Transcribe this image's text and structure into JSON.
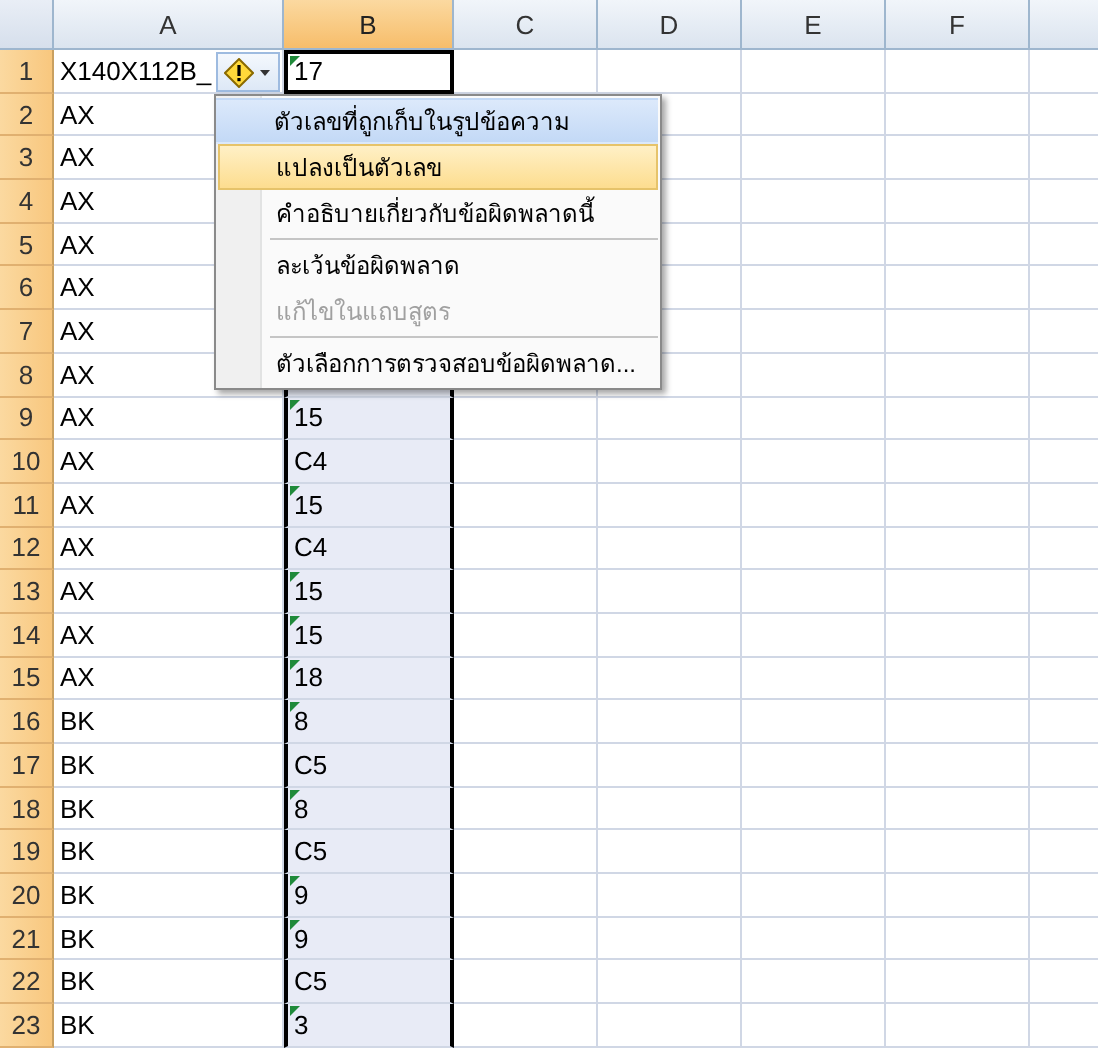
{
  "columns": [
    {
      "label": "A",
      "selected": false
    },
    {
      "label": "B",
      "selected": true
    },
    {
      "label": "C",
      "selected": false
    },
    {
      "label": "D",
      "selected": false
    },
    {
      "label": "E",
      "selected": false
    },
    {
      "label": "F",
      "selected": false
    }
  ],
  "rows": [
    {
      "number": "1",
      "a": "X140X112B_",
      "b": "17",
      "error_flag": true
    },
    {
      "number": "2",
      "a": "AX"
    },
    {
      "number": "3",
      "a": "AX"
    },
    {
      "number": "4",
      "a": "AX"
    },
    {
      "number": "5",
      "a": "AX"
    },
    {
      "number": "6",
      "a": "AX"
    },
    {
      "number": "7",
      "a": "AX"
    },
    {
      "number": "8",
      "a": "AX"
    },
    {
      "number": "9",
      "a": "AX",
      "b": "15",
      "error_flag": true
    },
    {
      "number": "10",
      "a": "AX",
      "b": "C4",
      "error_flag": false
    },
    {
      "number": "11",
      "a": "AX",
      "b": "15",
      "error_flag": true
    },
    {
      "number": "12",
      "a": "AX",
      "b": "C4",
      "error_flag": false
    },
    {
      "number": "13",
      "a": "AX",
      "b": "15",
      "error_flag": true
    },
    {
      "number": "14",
      "a": "AX",
      "b": "15",
      "error_flag": true
    },
    {
      "number": "15",
      "a": "AX",
      "b": "18",
      "error_flag": true
    },
    {
      "number": "16",
      "a": "BK",
      "b": "8",
      "error_flag": true
    },
    {
      "number": "17",
      "a": "BK",
      "b": "C5",
      "error_flag": false
    },
    {
      "number": "18",
      "a": "BK",
      "b": "8",
      "error_flag": true
    },
    {
      "number": "19",
      "a": "BK",
      "b": "C5",
      "error_flag": false
    },
    {
      "number": "20",
      "a": "BK",
      "b": "9",
      "error_flag": true
    },
    {
      "number": "21",
      "a": "BK",
      "b": "9",
      "error_flag": true
    },
    {
      "number": "22",
      "a": "BK",
      "b": "C5",
      "error_flag": false
    },
    {
      "number": "23",
      "a": "BK",
      "b": "3",
      "error_flag": true
    }
  ],
  "error_menu": {
    "items": [
      {
        "kind": "header",
        "label": "ตัวเลขที่ถูกเก็บในรูปข้อความ"
      },
      {
        "kind": "item",
        "label": "แปลงเป็นตัวเลข",
        "selected": true,
        "disabled": false
      },
      {
        "kind": "item",
        "label": "คำอธิบายเกี่ยวกับข้อผิดพลาดนี้",
        "selected": false,
        "disabled": false
      },
      {
        "kind": "separator"
      },
      {
        "kind": "item",
        "label": "ละเว้นข้อผิดพลาด",
        "selected": false,
        "disabled": false
      },
      {
        "kind": "item",
        "label": "แก้ไขในแถบสูตร",
        "selected": false,
        "disabled": true
      },
      {
        "kind": "separator"
      },
      {
        "kind": "item",
        "label": "ตัวเลือกการตรวจสอบข้อผิดพลาด...",
        "selected": false,
        "disabled": false
      }
    ]
  }
}
